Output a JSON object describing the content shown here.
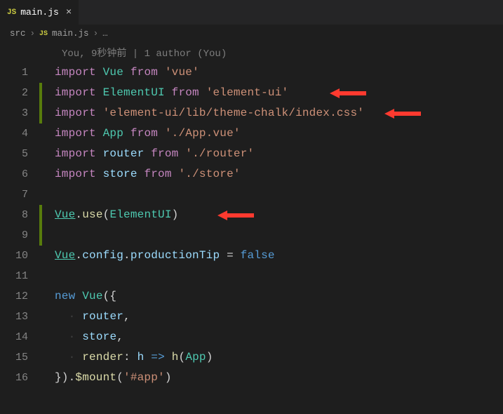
{
  "tab": {
    "badge": "JS",
    "label": "main.js",
    "close": "×"
  },
  "breadcrumb": {
    "src": "src",
    "chev1": "›",
    "badge": "JS",
    "file": "main.js",
    "chev2": "›",
    "ellipsis": "…"
  },
  "git_info": "You, 9秒钟前 | 1 author (You)",
  "lines": {
    "1": {
      "import": "import",
      "id": "Vue",
      "from": "from",
      "str": "'vue'"
    },
    "2": {
      "import": "import",
      "id": "ElementUI",
      "from": "from",
      "str": "'element-ui'"
    },
    "3": {
      "import": "import",
      "str": "'element-ui/lib/theme-chalk/index.css'"
    },
    "4": {
      "import": "import",
      "id": "App",
      "from": "from",
      "str": "'./App.vue'"
    },
    "5": {
      "import": "import",
      "id": "router",
      "from": "from",
      "str": "'./router'"
    },
    "6": {
      "import": "import",
      "id": "store",
      "from": "from",
      "str": "'./store'"
    },
    "8": {
      "vue": "Vue",
      "dot": ".",
      "use": "use",
      "open": "(",
      "arg": "ElementUI",
      "close": ")"
    },
    "10": {
      "vue": "Vue",
      "d1": ".",
      "config": "config",
      "d2": ".",
      "tip": "productionTip",
      "eq": " = ",
      "false": "false"
    },
    "12": {
      "new": "new",
      "sp": " ",
      "vue": "Vue",
      "open": "({"
    },
    "13": {
      "guide": "·",
      "id": "router",
      "comma": ","
    },
    "14": {
      "guide": "·",
      "id": "store",
      "comma": ","
    },
    "15": {
      "guide": "·",
      "render": "render",
      "colon": ": ",
      "h1": "h",
      "arrow": " => ",
      "hfn": "h",
      "open": "(",
      "app": "App",
      "close": ")"
    },
    "16": {
      "close": "}).",
      "mount": "$mount",
      "open": "(",
      "str": "'#app'",
      "cparen": ")"
    }
  },
  "line_numbers": {
    "1": "1",
    "2": "2",
    "3": "3",
    "4": "4",
    "5": "5",
    "6": "6",
    "7": "7",
    "8": "8",
    "9": "9",
    "10": "10",
    "11": "11",
    "12": "12",
    "13": "13",
    "14": "14",
    "15": "15",
    "16": "16"
  }
}
